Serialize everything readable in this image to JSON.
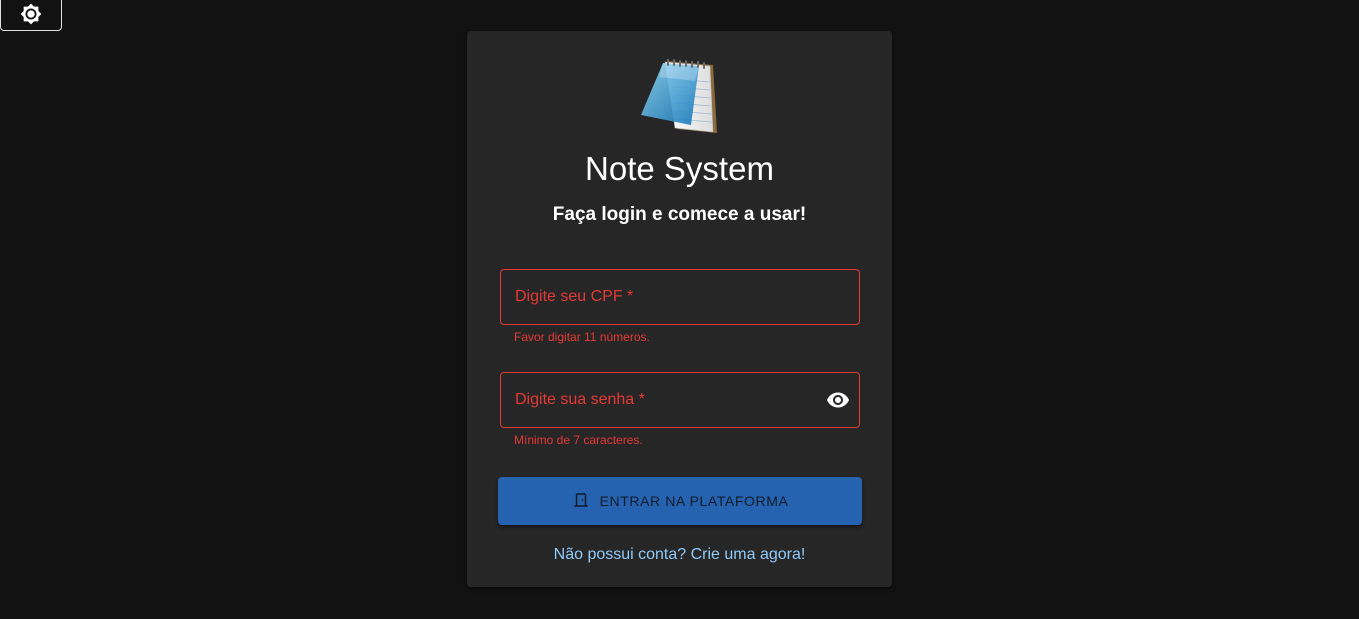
{
  "header": {
    "theme_toggle_icon": "brightness-icon"
  },
  "login": {
    "logo_icon": "notepad-icon",
    "title": "Note System",
    "subtitle": "Faça login e comece a usar!",
    "cpf": {
      "label": "Digite seu CPF *",
      "value": "",
      "error": "Favor digitar 11 números."
    },
    "password": {
      "label": "Digite sua senha *",
      "value": "",
      "error": "Mínimo de 7 caracteres.",
      "toggle_icon": "eye-icon"
    },
    "submit": {
      "label": "ENTRAR NA PLATAFORMA",
      "icon": "door-icon"
    },
    "signup_link": "Não possui conta? Crie uma agora!"
  },
  "colors": {
    "background": "#121212",
    "card": "#262626",
    "error": "#e53935",
    "primary": "#2563b0",
    "link": "#90caf9"
  }
}
